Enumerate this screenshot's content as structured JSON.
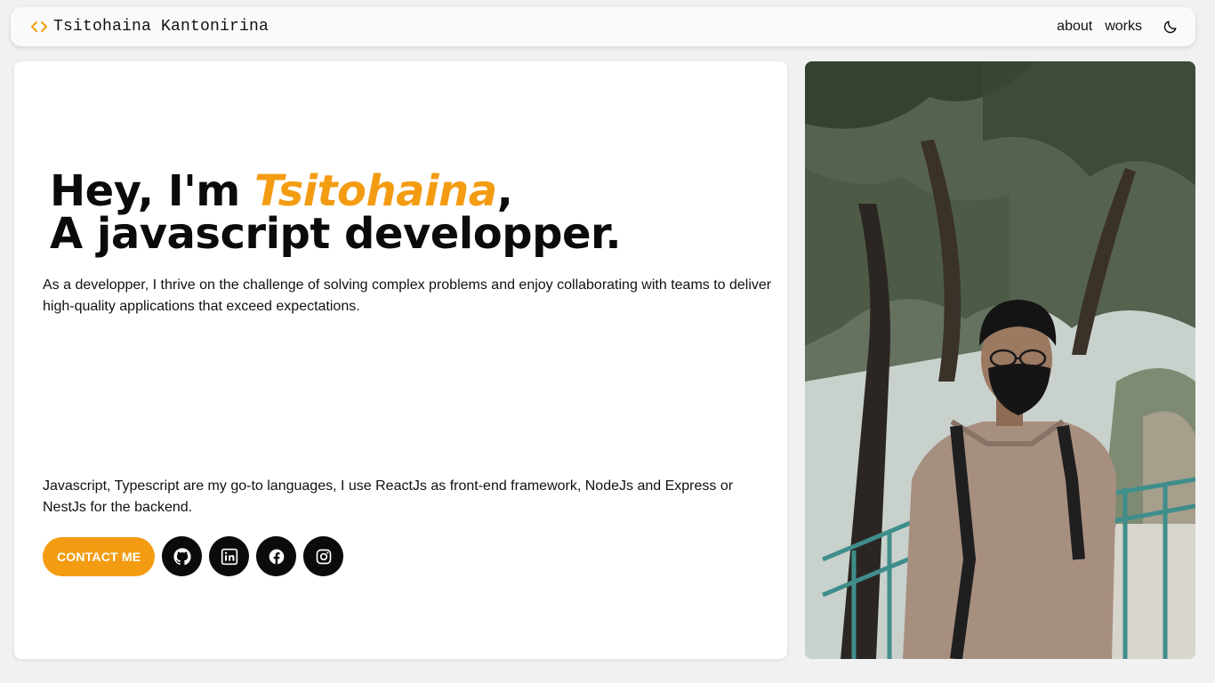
{
  "navbar": {
    "brand_name": "Tsitohaina Kantonirina",
    "links": [
      "about",
      "works"
    ],
    "icons": {
      "brand": "code-brackets-icon",
      "theme": "moon-icon"
    }
  },
  "hero": {
    "headline_greeting": "Hey, I'm ",
    "headline_name": "Tsitohaina",
    "headline_comma": ",",
    "headline_role": "A javascript developper.",
    "intro": "As a developper, I thrive on the challenge of solving complex problems and enjoy collaborating with teams to deliver high-quality applications that exceed expectations.",
    "stack": "Javascript, Typescript are my go-to languages, I use ReactJs as front-end framework, NodeJs and Express or NestJs for the backend.",
    "contact_label": "CONTACT ME",
    "socials": [
      "github-icon",
      "linkedin-icon",
      "facebook-icon",
      "instagram-icon"
    ]
  },
  "colors": {
    "accent": "#f39c12",
    "background": "#f1f1f1",
    "card": "#ffffff",
    "text": "#111111",
    "social_bg": "#0b0b0b"
  },
  "photo": {
    "icon": "portrait-photo"
  }
}
